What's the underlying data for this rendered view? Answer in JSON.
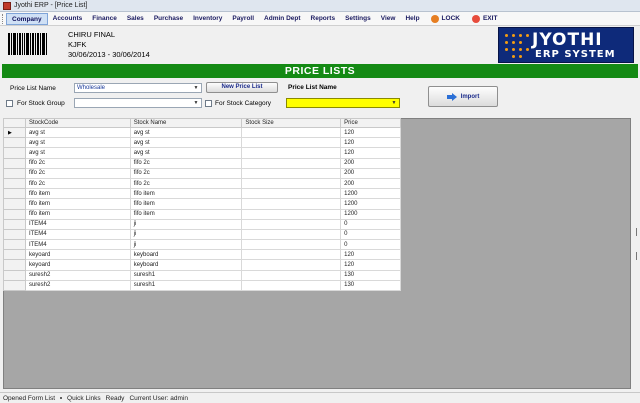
{
  "window": {
    "title": "Jyothi ERP - [Price List]"
  },
  "menu": {
    "items": [
      "Company",
      "Accounts",
      "Finance",
      "Sales",
      "Purchase",
      "Inventory",
      "Payroll",
      "Admin Dept",
      "Reports",
      "Settings",
      "View",
      "Help"
    ],
    "lock_label": "LOCK",
    "exit_label": "EXIT"
  },
  "header": {
    "company_name": "CHIRU FINAL",
    "company_code": "KJFK",
    "period": "30/06/2013 - 30/06/2014",
    "logo_line1": "JYOTHI",
    "logo_line2": "ERP SYSTEM"
  },
  "banner": {
    "title": "PRICE LISTS"
  },
  "form": {
    "price_list_name_label": "Price List Name",
    "price_list_name_value": "Wholesale",
    "new_price_list_button": "New Price List",
    "price_list_name_caption": "Price List Name",
    "stock_group_label": "For Stock Group",
    "stock_group_value": "",
    "stock_category_label": "For Stock Category",
    "stock_category_value": "",
    "import_button": "Import"
  },
  "grid": {
    "columns": [
      "StockCode",
      "Stock Name",
      "Stock Size",
      "Price"
    ],
    "rows": [
      [
        "avg st",
        "avg st",
        "",
        "120"
      ],
      [
        "avg st",
        "avg st",
        "",
        "120"
      ],
      [
        "avg st",
        "avg st",
        "",
        "120"
      ],
      [
        "fifo 2c",
        "fifo 2c",
        "",
        "200"
      ],
      [
        "fifo 2c",
        "fifo 2c",
        "",
        "200"
      ],
      [
        "fifo 2c",
        "fifo 2c",
        "",
        "200"
      ],
      [
        "fifo item",
        "fifo item",
        "",
        "1200"
      ],
      [
        "fifo item",
        "fifo item",
        "",
        "1200"
      ],
      [
        "fifo item",
        "fifo item",
        "",
        "1200"
      ],
      [
        "ITEM4",
        "ji",
        "",
        "0"
      ],
      [
        "ITEM4",
        "ji",
        "",
        "0"
      ],
      [
        "ITEM4",
        "ji",
        "",
        "0"
      ],
      [
        "keyoard",
        "keyboard",
        "",
        "120"
      ],
      [
        "keyoard",
        "keyboard",
        "",
        "120"
      ],
      [
        "suresh2",
        "suresh1",
        "",
        "130"
      ],
      [
        "suresh2",
        "suresh1",
        "",
        "130"
      ]
    ]
  },
  "status": {
    "opened_form_list": "Opened Form List",
    "quick_links": "Quick Links",
    "ready": "Ready",
    "current_user": "Current User: admin"
  },
  "colors": {
    "banner": "#148a14",
    "logo_bg": "#0e2a7a",
    "category_field": "#ffff00",
    "grid_backdrop": "#a6a6a6"
  }
}
